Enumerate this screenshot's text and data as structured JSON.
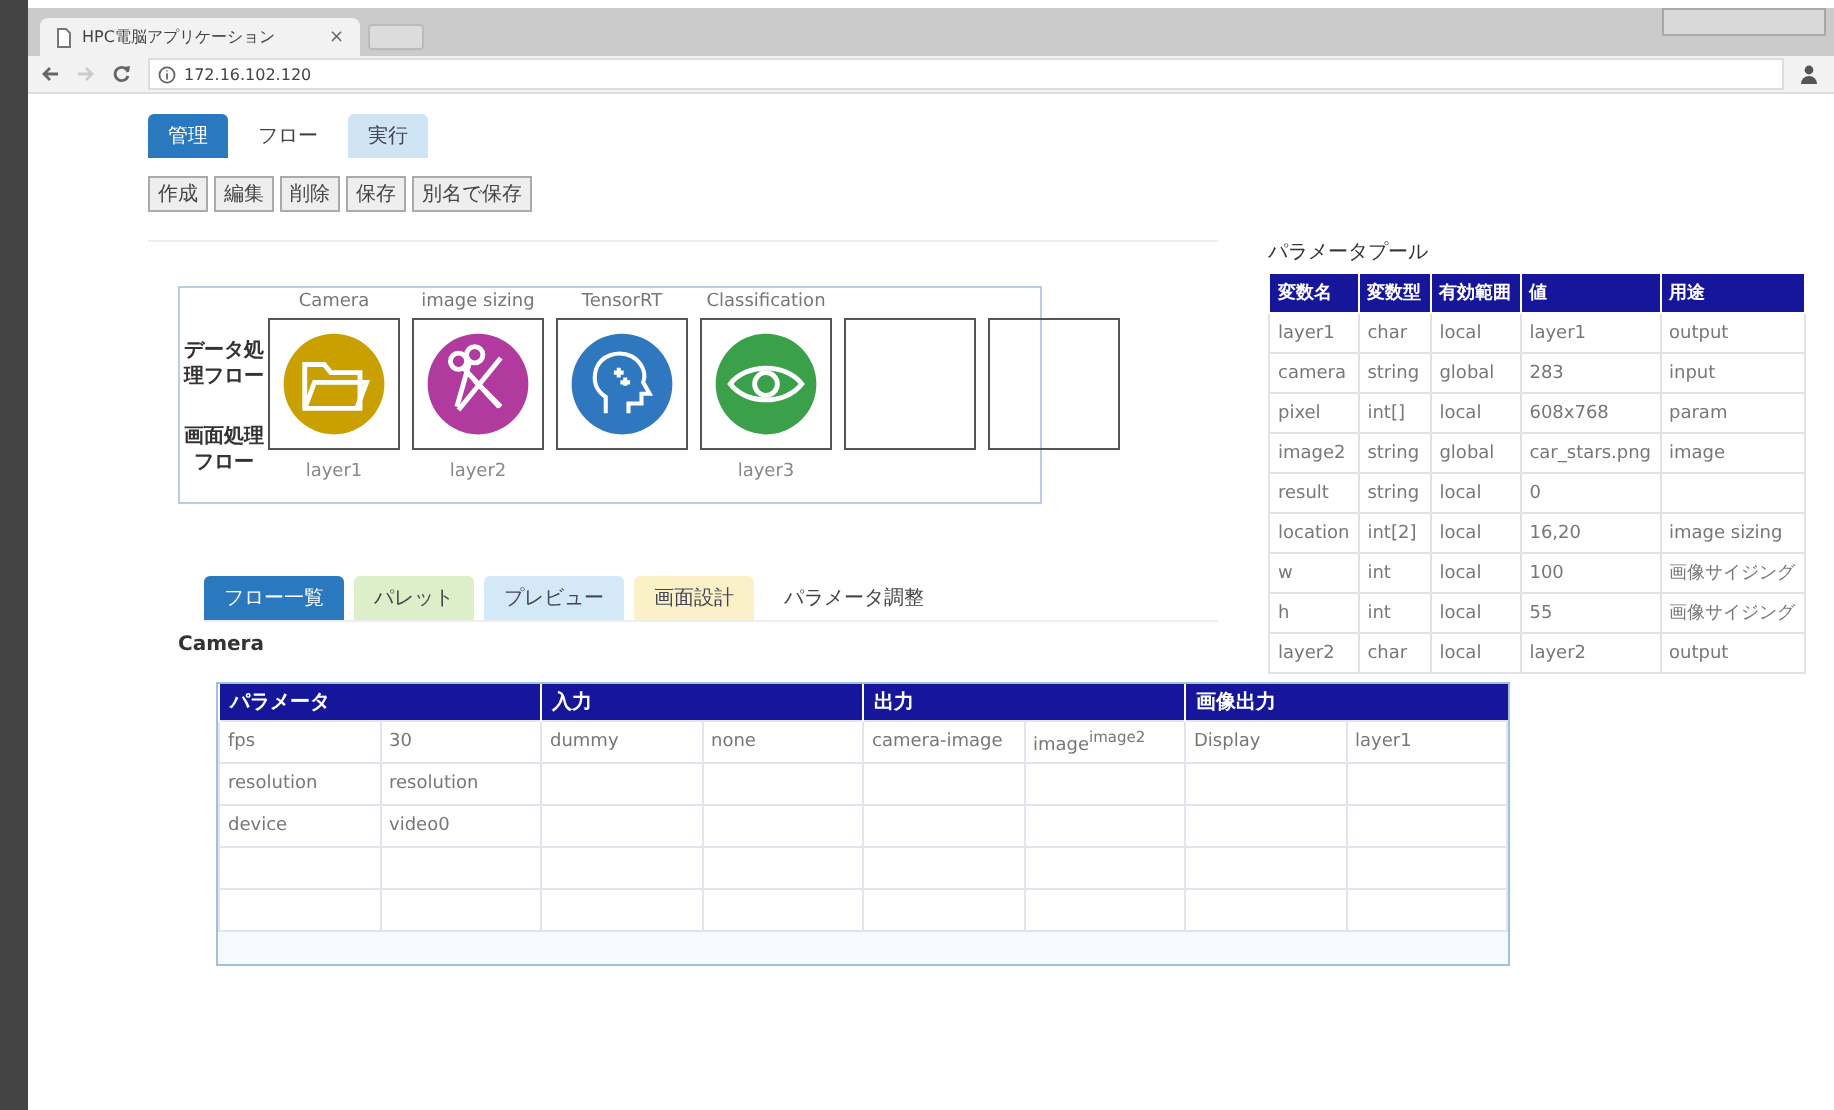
{
  "browser": {
    "tab_title": "HPC電脳アプリケーション",
    "tab_close": "×",
    "url": "172.16.102.120"
  },
  "top_tabs": [
    {
      "label": "管理",
      "selected": false,
      "color": "#2a78bd"
    },
    {
      "label": "フロー",
      "selected": true
    },
    {
      "label": "実行",
      "selected": false,
      "color": "#cfe5f5"
    }
  ],
  "toolbar": [
    "作成",
    "編集",
    "削除",
    "保存",
    "別名で保存"
  ],
  "flow": {
    "row_labels": [
      "データ処理フロー",
      "画面処理フロー"
    ],
    "nodes": [
      {
        "kind": "camera",
        "title": "Camera",
        "color": "#c9a000",
        "layer": "layer1"
      },
      {
        "kind": "image_sizing",
        "title": "image sizing",
        "color": "#b03a9e",
        "layer": "layer2"
      },
      {
        "kind": "tensorrt",
        "title": "TensorRT",
        "color": "#2f78c0"
      },
      {
        "kind": "classification",
        "title": "Classification",
        "color": "#3aa04a",
        "layer": "layer3"
      },
      {
        "kind": "empty"
      },
      {
        "kind": "empty"
      }
    ]
  },
  "bottom_tabs": [
    {
      "label": "フロー一覧",
      "selected": false,
      "color": "#2a78bd"
    },
    {
      "label": "パレット",
      "selected": false,
      "color": "#dcefc8"
    },
    {
      "label": "プレビュー",
      "selected": false,
      "color": "#d4e9f7"
    },
    {
      "label": "画面設計",
      "selected": false,
      "color": "#fbf1c8"
    },
    {
      "label": "パラメータ調整",
      "selected": true
    }
  ],
  "param_section": {
    "title": "Camera",
    "groups": [
      "パラメータ",
      "入力",
      "出力",
      "画像出力"
    ],
    "rows": [
      [
        "fps",
        "30",
        "dummy",
        "none",
        "camera-image",
        "image$^{image2}$",
        "Display",
        "layer1"
      ],
      [
        "resolution",
        "resolution",
        "",
        "",
        "",
        "",
        "",
        ""
      ],
      [
        "device",
        "video0",
        "",
        "",
        "",
        "",
        "",
        ""
      ],
      [
        "",
        "",
        "",
        "",
        "",
        "",
        "",
        ""
      ],
      [
        "",
        "",
        "",
        "",
        "",
        "",
        "",
        ""
      ]
    ]
  },
  "parameter_pool": {
    "title": "パラメータプール",
    "columns": [
      "変数名",
      "変数型",
      "有効範囲",
      "値",
      "用途"
    ],
    "rows": [
      [
        "layer1",
        "char",
        "local",
        "layer1",
        "output"
      ],
      [
        "camera",
        "string",
        "global",
        "283",
        "input"
      ],
      [
        "pixel",
        "int[]",
        "local",
        "608x768",
        "param"
      ],
      [
        "image2",
        "string",
        "global",
        "car_stars.png",
        "image"
      ],
      [
        "result",
        "string",
        "local",
        "0",
        ""
      ],
      [
        "location",
        "int[2]",
        "local",
        "16,20",
        "image sizing"
      ],
      [
        "w",
        "int",
        "local",
        "100",
        "画像サイジング"
      ],
      [
        "h",
        "int",
        "local",
        "55",
        "画像サイジング"
      ],
      [
        "layer2",
        "char",
        "local",
        "layer2",
        "output"
      ]
    ]
  }
}
